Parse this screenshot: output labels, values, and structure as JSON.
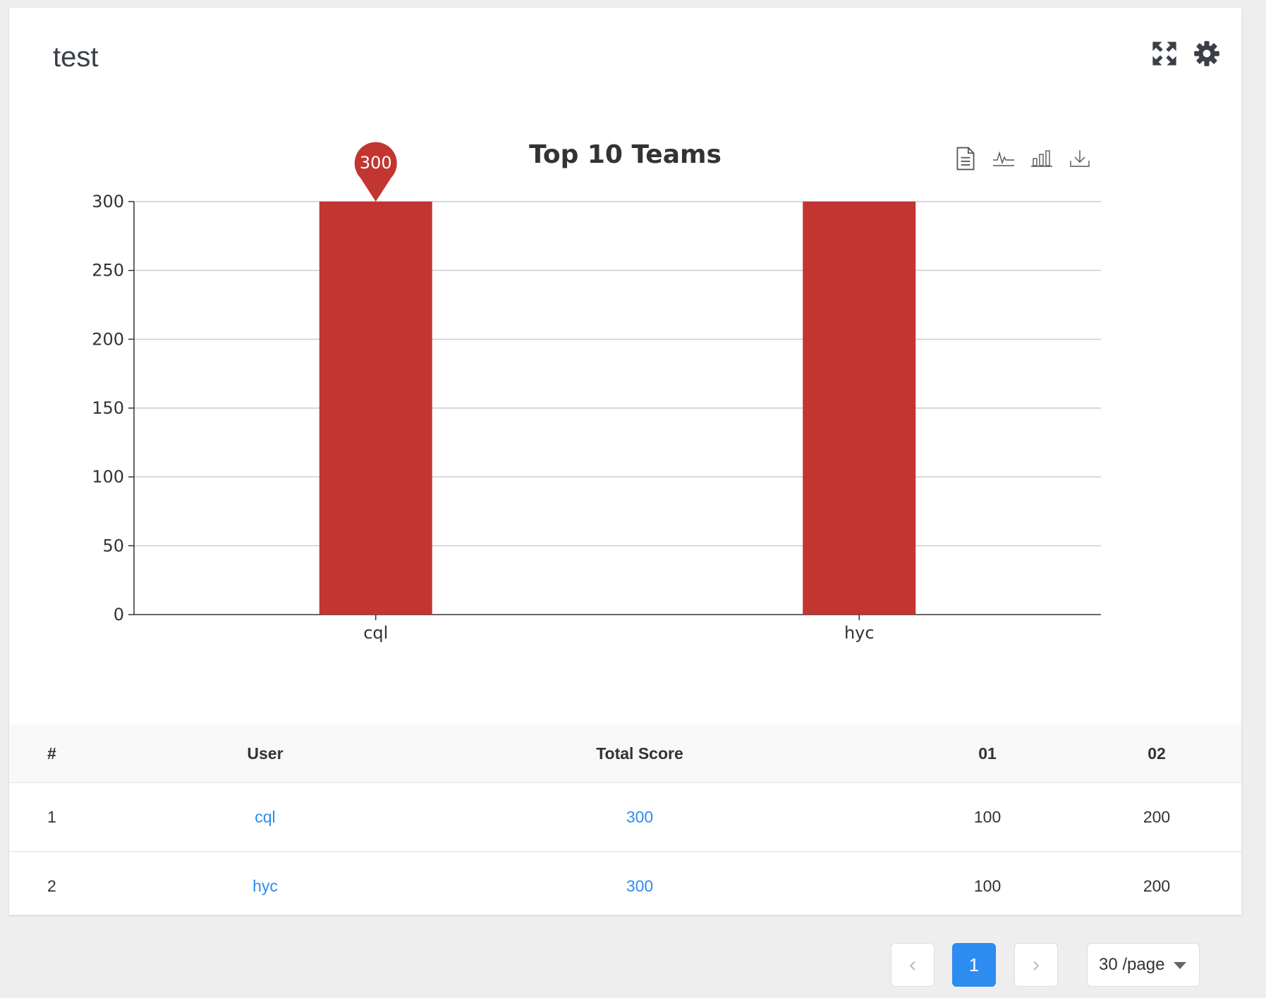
{
  "card": {
    "title": "test"
  },
  "icons": {
    "fullscreen": "expand-arrows-icon",
    "settings": "gear-icon"
  },
  "chart_tools": [
    "data-view-icon",
    "line-chart-icon",
    "bar-chart-icon",
    "download-icon"
  ],
  "chart_data": {
    "type": "bar",
    "title": "Top 10 Teams",
    "categories": [
      "cql",
      "hyc"
    ],
    "values": [
      300,
      300
    ],
    "ylim": [
      0,
      300
    ],
    "yticks": [
      0,
      50,
      100,
      150,
      200,
      250,
      300
    ],
    "bar_color": "#c23531",
    "markpoint": {
      "category": "cql",
      "label": "300"
    },
    "grid": true
  },
  "table": {
    "headers": [
      "#",
      "User",
      "Total Score",
      "01",
      "02"
    ],
    "rows": [
      {
        "rank": "1",
        "user": "cql",
        "total": "300",
        "c01": "100",
        "c02": "200"
      },
      {
        "rank": "2",
        "user": "hyc",
        "total": "300",
        "c01": "100",
        "c02": "200"
      }
    ]
  },
  "pagination": {
    "prev": "‹",
    "current": "1",
    "next": "›",
    "page_size": "30 /page"
  },
  "colors": {
    "accent": "#2d8cf0",
    "bar": "#c23531",
    "background": "#eeeeee"
  }
}
